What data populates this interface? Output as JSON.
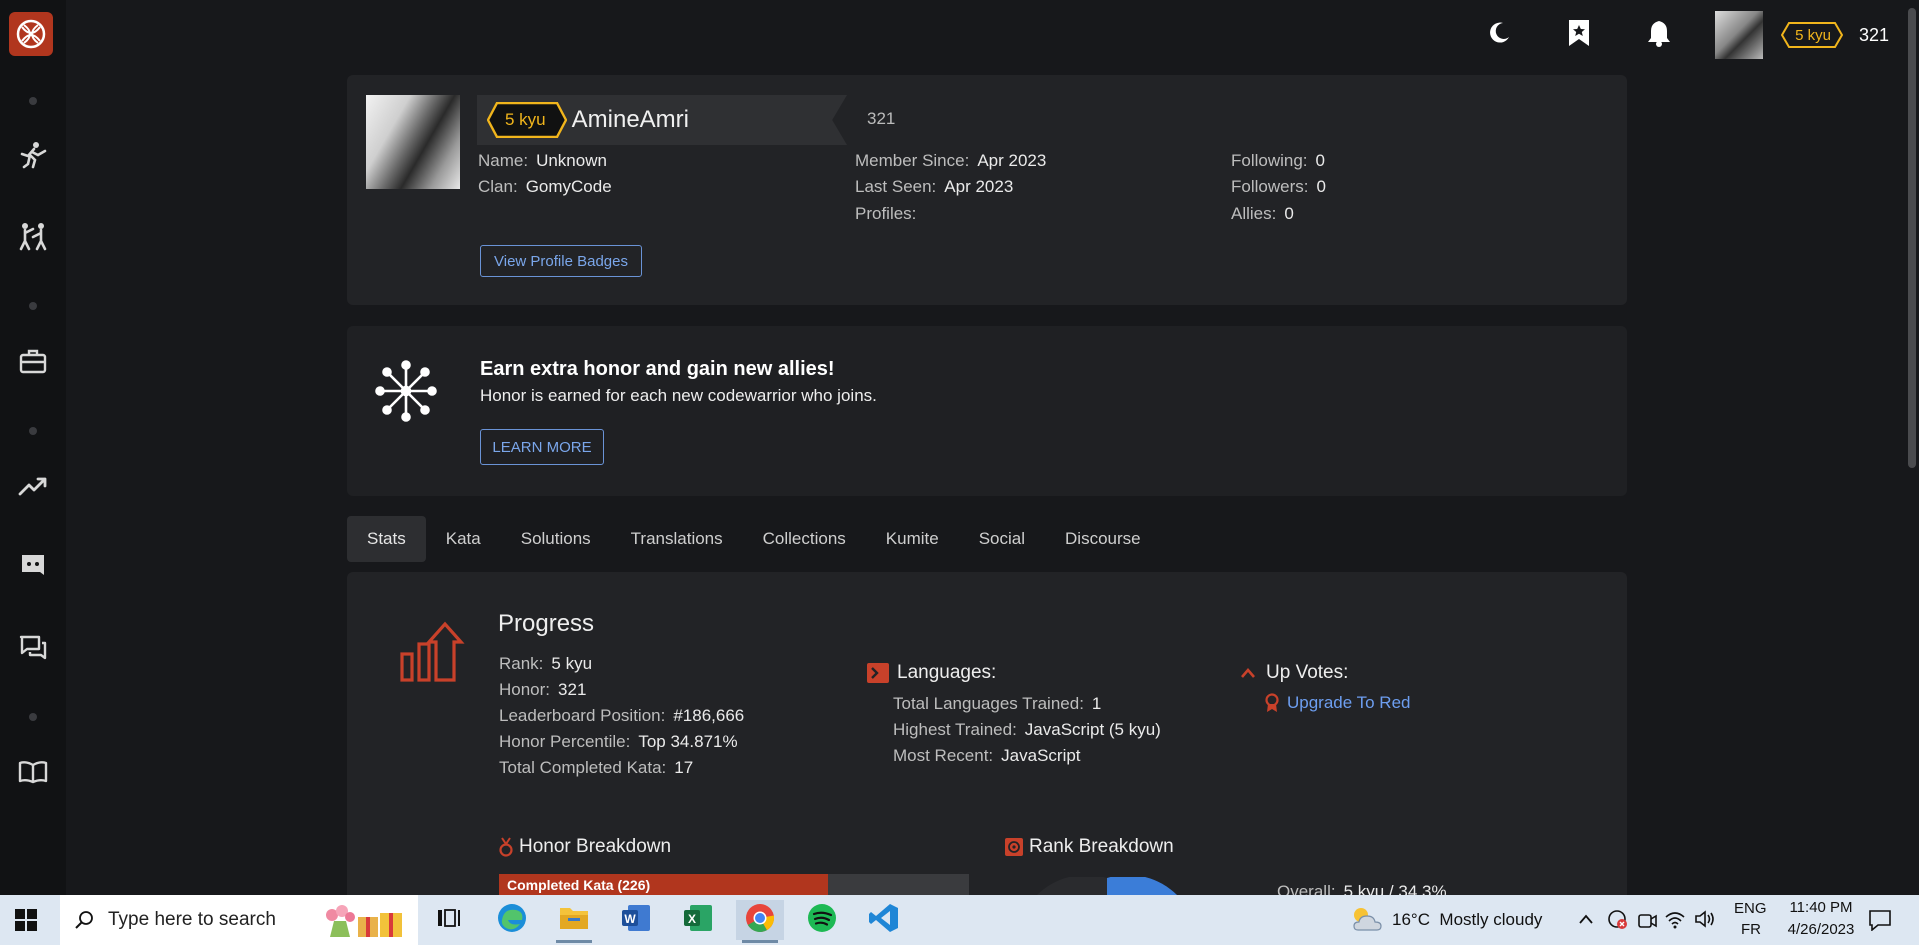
{
  "topbar": {
    "rank": "5 kyu",
    "honor": "321"
  },
  "profile": {
    "rank": "5 kyu",
    "username": "AmineAmri",
    "honor": "321",
    "name_label": "Name:",
    "name_value": "Unknown",
    "clan_label": "Clan:",
    "clan_value": "GomyCode",
    "member_since_label": "Member Since:",
    "member_since_value": "Apr 2023",
    "last_seen_label": "Last Seen:",
    "last_seen_value": "Apr 2023",
    "profiles_label": "Profiles:",
    "following_label": "Following:",
    "following_value": "0",
    "followers_label": "Followers:",
    "followers_value": "0",
    "allies_label": "Allies:",
    "allies_value": "0",
    "view_badges_label": "View Profile Badges"
  },
  "invite": {
    "title": "Earn extra honor and gain new allies!",
    "text": "Honor is earned for each new codewarrior who joins.",
    "button": "LEARN MORE"
  },
  "tabs": [
    "Stats",
    "Kata",
    "Solutions",
    "Translations",
    "Collections",
    "Kumite",
    "Social",
    "Discourse"
  ],
  "progress": {
    "title": "Progress",
    "rank_label": "Rank:",
    "rank_value": "5 kyu",
    "honor_label": "Honor:",
    "honor_value": "321",
    "leaderboard_label": "Leaderboard Position:",
    "leaderboard_value": "#186,666",
    "percentile_label": "Honor Percentile:",
    "percentile_value": "Top 34.871%",
    "completed_label": "Total Completed Kata:",
    "completed_value": "17"
  },
  "languages": {
    "title": "Languages:",
    "total_label": "Total Languages Trained:",
    "total_value": "1",
    "highest_label": "Highest Trained:",
    "highest_value": "JavaScript (5 kyu)",
    "recent_label": "Most Recent:",
    "recent_value": "JavaScript"
  },
  "upvotes": {
    "title": "Up Votes:",
    "link": "Upgrade To Red"
  },
  "honor_breakdown": {
    "title": "Honor Breakdown",
    "bar_label": "Completed Kata (226)",
    "fraction": 0.7
  },
  "rank_breakdown": {
    "title": "Rank Breakdown",
    "overall_label": "Overall:",
    "overall_value": "5 kyu / 34.3%"
  },
  "taskbar": {
    "search_placeholder": "Type here to search",
    "weather": "16°C  Mostly cloudy",
    "lang_top": "ENG",
    "lang_bottom": "FR",
    "time": "11:40 PM",
    "date": "4/26/2023"
  },
  "colors": {
    "accent": "#b1361e",
    "kyu": "#f1b51c",
    "link": "#6d9ef0"
  }
}
